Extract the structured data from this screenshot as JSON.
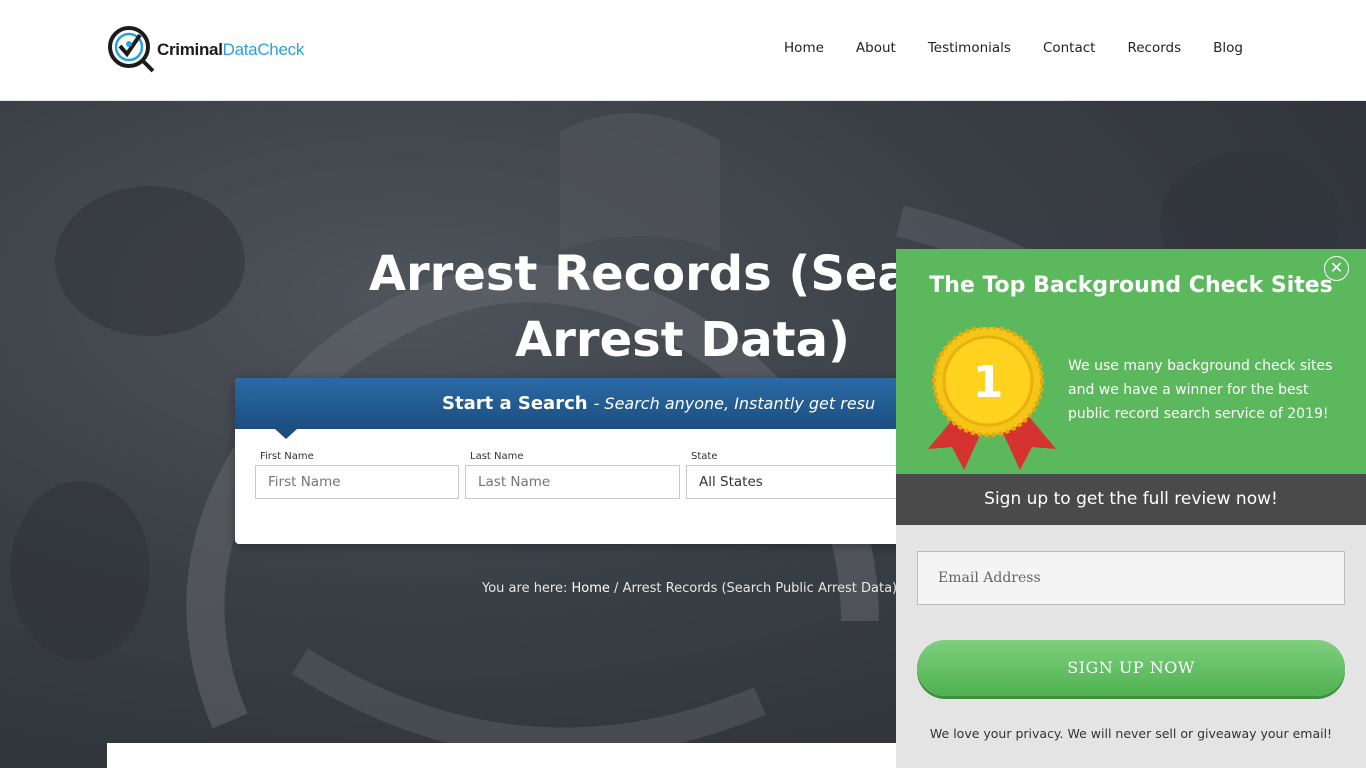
{
  "brand": {
    "name_part1": "Criminal",
    "name_part2": "DataCheck"
  },
  "nav": {
    "items": [
      "Home",
      "About",
      "Testimonials",
      "Contact",
      "Records",
      "Blog"
    ]
  },
  "hero": {
    "title_line1": "Arrest Records (Search",
    "title_line2": "Arrest Data)"
  },
  "search": {
    "title": "Start a Search",
    "subtitle": "- Search anyone, Instantly get resu",
    "first_name_label": "First Name",
    "first_name_placeholder": "First Name",
    "last_name_label": "Last Name",
    "last_name_placeholder": "Last Name",
    "state_label": "State",
    "state_value": "All States"
  },
  "breadcrumb": {
    "prefix": "You are here:",
    "home": "Home",
    "separator": "/",
    "current": "Arrest Records (Search Public Arrest Data)"
  },
  "popup": {
    "title": "The Top Background Check Sites",
    "close": "✕",
    "medal_number": "1",
    "description": "We use many background check sites and we have a winner for the best public record search service of 2019!",
    "band": "Sign up to get the full review now!",
    "email_placeholder": "Email Address",
    "button": "SIGN UP NOW",
    "privacy": "We love your privacy.  We will never sell or giveaway your email!"
  },
  "colors": {
    "popup_green": "#5cb85c",
    "brand_blue": "#29a3d9",
    "search_blue": "#1c4f80"
  }
}
